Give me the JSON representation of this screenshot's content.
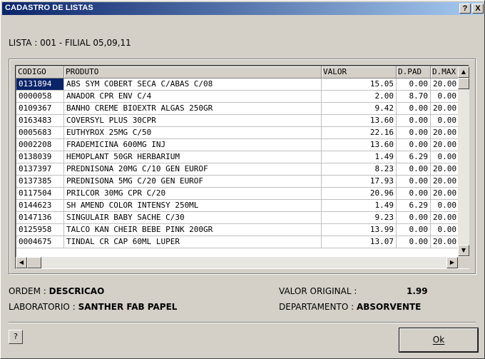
{
  "window": {
    "title": "CADASTRO DE LISTAS",
    "help_btn": "?",
    "close_btn": "X"
  },
  "lista_label": "LISTA : 001 - FILIAL 05,09,11",
  "grid": {
    "columns": [
      "CODIGO",
      "PRODUTO",
      "VALOR",
      "D.PAD",
      "D.MAX"
    ],
    "rows": [
      [
        "0131894",
        "ABS SYM COBERT SECA C/ABAS C/08",
        "15.05",
        "0.00",
        "20.00"
      ],
      [
        "0000058",
        "ANADOR CPR ENV C/4",
        "2.00",
        "8.70",
        "0.00"
      ],
      [
        "0109367",
        "BANHO CREME BIOEXTR ALGAS 250GR",
        "9.42",
        "0.00",
        "20.00"
      ],
      [
        "0163483",
        "COVERSYL PLUS 30CPR",
        "13.60",
        "0.00",
        "0.00"
      ],
      [
        "0005683",
        "EUTHYROX 25MG C/50",
        "22.16",
        "0.00",
        "20.00"
      ],
      [
        "0002208",
        "FRADEMICINA 600MG INJ",
        "13.60",
        "0.00",
        "20.00"
      ],
      [
        "0138039",
        "HEMOPLANT 50GR HERBARIUM",
        "1.49",
        "6.29",
        "0.00"
      ],
      [
        "0137397",
        "PREDNISONA 20MG C/10 GEN EUROF",
        "8.23",
        "0.00",
        "20.00"
      ],
      [
        "0137385",
        "PREDNISONA 5MG C/20 GEN EUROF",
        "17.93",
        "0.00",
        "20.00"
      ],
      [
        "0117504",
        "PRILCOR 30MG CPR C/20",
        "20.96",
        "0.00",
        "20.00"
      ],
      [
        "0144623",
        "SH AMEND COLOR INTENSY 250ML",
        "1.49",
        "6.29",
        "0.00"
      ],
      [
        "0147136",
        "SINGULAIR BABY SACHE C/30",
        "9.23",
        "0.00",
        "20.00"
      ],
      [
        "0125958",
        "TALCO KAN CHEIR BEBE PINK 200GR",
        "13.99",
        "0.00",
        "0.00"
      ],
      [
        "0004675",
        "TINDAL CR CAP 60ML LUPER",
        "13.07",
        "0.00",
        "20.00"
      ]
    ],
    "selected_row": 0
  },
  "info": {
    "ordem_label": "ORDEM :",
    "ordem_value": "DESCRICAO",
    "laboratorio_label": "LABORATORIO :",
    "laboratorio_value": "SANTHER FAB PAPEL",
    "valor_original_label": "VALOR ORIGINAL :",
    "valor_original_value": "1.99",
    "departamento_label": "DEPARTAMENTO :",
    "departamento_value": "ABSORVENTE"
  },
  "buttons": {
    "help": "?",
    "ok": "Ok"
  },
  "colors": {
    "title_gradient_start": "#0a246a",
    "title_gradient_end": "#a6caf0",
    "selection": "#0a246a",
    "face": "#d4d0c8"
  }
}
